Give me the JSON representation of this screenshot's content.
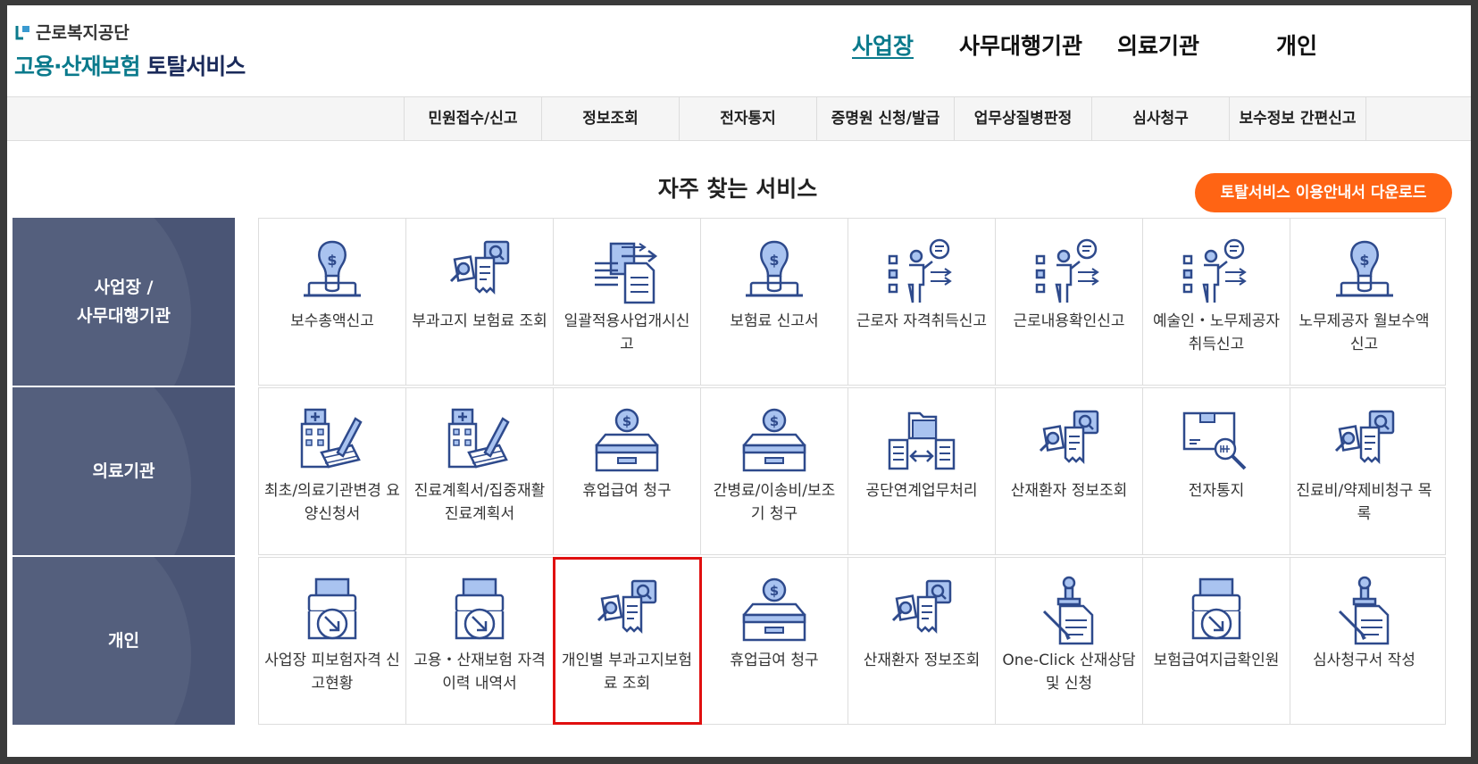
{
  "logo": {
    "org": "근로복지공단",
    "main_accent": "고용·산재보험",
    "main_rest": " 토탈서비스"
  },
  "topnav": [
    "사업장",
    "사무대행기관",
    "의료기관",
    "개인"
  ],
  "subnav": [
    "민원접수/신고",
    "정보조회",
    "전자통지",
    "증명원 신청/발급",
    "업무상질병판정",
    "심사청구",
    "보수정보 간편신고"
  ],
  "services_title": "자주 찾는 서비스",
  "download_button": "토탈서비스 이용안내서 다운로드",
  "rows": [
    {
      "label": "사업장 /\n사무대행기관",
      "items": [
        {
          "label": "보수총액신고",
          "icon": "money-bulb-icon"
        },
        {
          "label": "부과고지 보험료 조회",
          "icon": "document-search-icon"
        },
        {
          "label": "일괄적용사업개시신고",
          "icon": "document-arrows-icon"
        },
        {
          "label": "보험료 신고서",
          "icon": "money-bulb-icon"
        },
        {
          "label": "근로자 자격취득신고",
          "icon": "person-checklist-icon"
        },
        {
          "label": "근로내용확인신고",
          "icon": "person-checklist-icon"
        },
        {
          "label": "예술인・노무제공자 취득신고",
          "icon": "person-checklist-icon"
        },
        {
          "label": "노무제공자 월보수액 신고",
          "icon": "money-bulb-icon"
        }
      ]
    },
    {
      "label": "의료기관",
      "items": [
        {
          "label": "최초/의료기관변경 요양신청서",
          "icon": "hospital-pen-icon"
        },
        {
          "label": "진료계획서/집중재활진료계획서",
          "icon": "hospital-pen-icon"
        },
        {
          "label": "휴업급여 청구",
          "icon": "money-box-icon"
        },
        {
          "label": "간병료/이송비/보조기 청구",
          "icon": "money-box-icon"
        },
        {
          "label": "공단연계업무처리",
          "icon": "folder-exchange-icon"
        },
        {
          "label": "산재환자 정보조회",
          "icon": "document-search-icon"
        },
        {
          "label": "전자통지",
          "icon": "box-search-icon"
        },
        {
          "label": "진료비/약제비청구 목록",
          "icon": "document-search-icon"
        }
      ]
    },
    {
      "label": "개인",
      "items": [
        {
          "label": "사업장 피보험자격 신고현황",
          "icon": "printer-arrow-icon"
        },
        {
          "label": "고용・산재보험 자격 이력 내역서",
          "icon": "printer-arrow-icon"
        },
        {
          "label": "개인별 부과고지보험료 조회",
          "icon": "document-search-icon",
          "highlighted": true
        },
        {
          "label": "휴업급여 청구",
          "icon": "money-box-icon"
        },
        {
          "label": "산재환자 정보조회",
          "icon": "document-search-icon"
        },
        {
          "label": "One-Click 산재상담 및 신청",
          "icon": "stamp-document-icon"
        },
        {
          "label": "보험급여지급확인원",
          "icon": "printer-arrow-icon"
        },
        {
          "label": "심사청구서 작성",
          "icon": "stamp-document-icon"
        }
      ]
    }
  ],
  "colors": {
    "accent": "#0a7a8c",
    "cta": "#ff6414",
    "row_label_bg": "#4a5575",
    "highlight": "#e01010",
    "icon_blue": "#2e4a8c",
    "icon_light": "#a9c3f0"
  }
}
